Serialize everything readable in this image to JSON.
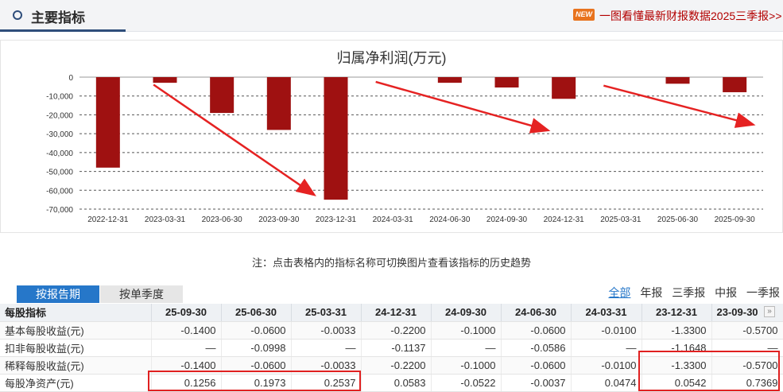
{
  "header": {
    "title": "主要指标",
    "new_badge": "NEW",
    "promo_link": "一图看懂最新财报数据2025三季报>>"
  },
  "chart_data": {
    "type": "bar",
    "title": "归属净利润(万元)",
    "categories": [
      "2022-12-31",
      "2023-03-31",
      "2023-06-30",
      "2023-09-30",
      "2023-12-31",
      "2024-03-31",
      "2024-06-30",
      "2024-09-30",
      "2024-12-31",
      "2025-03-31",
      "2025-06-30",
      "2025-09-30"
    ],
    "values": [
      -48000,
      -3000,
      -19000,
      -28000,
      -65000,
      0,
      -3000,
      -5500,
      -11500,
      0,
      -3500,
      -8000
    ],
    "yticks": [
      0,
      -10000,
      -20000,
      -30000,
      -40000,
      -50000,
      -60000,
      -70000
    ],
    "ytick_labels": [
      "0",
      "-10,000",
      "-20,000",
      "-30,000",
      "-40,000",
      "-50,000",
      "-60,000",
      "-70,000"
    ],
    "ylim": [
      -70000,
      0
    ],
    "grid": true,
    "bar_color": "#9f1111",
    "arrow_color": "#e52222"
  },
  "note": "注：点击表格内的指标名称可切换图片查看该指标的历史趋势",
  "tabs": {
    "by_period": "按报告期",
    "by_quarter": "按单季度"
  },
  "filters": [
    "全部",
    "年报",
    "三季报",
    "中报",
    "一季报"
  ],
  "table": {
    "header_label": "每股指标",
    "columns": [
      "25-09-30",
      "25-06-30",
      "25-03-31",
      "24-12-31",
      "24-09-30",
      "24-06-30",
      "24-03-31",
      "23-12-31",
      "23-09-30"
    ],
    "rows": [
      {
        "label": "基本每股收益(元)",
        "values": [
          "-0.1400",
          "-0.0600",
          "-0.0033",
          "-0.2200",
          "-0.1000",
          "-0.0600",
          "-0.0100",
          "-1.3300",
          "-0.5700"
        ]
      },
      {
        "label": "扣非每股收益(元)",
        "values": [
          "—",
          "-0.0998",
          "—",
          "-0.1137",
          "—",
          "-0.0586",
          "—",
          "-1.1648",
          "—"
        ]
      },
      {
        "label": "稀释每股收益(元)",
        "values": [
          "-0.1400",
          "-0.0600",
          "-0.0033",
          "-0.2200",
          "-0.1000",
          "-0.0600",
          "-0.0100",
          "-1.3300",
          "-0.5700"
        ]
      },
      {
        "label": "每股净资产(元)",
        "values": [
          "0.1256",
          "0.1973",
          "0.2537",
          "0.0583",
          "-0.0522",
          "-0.0037",
          "0.0474",
          "0.0542",
          "0.7369"
        ]
      }
    ],
    "next_icon": "chevron-right-double-icon"
  }
}
